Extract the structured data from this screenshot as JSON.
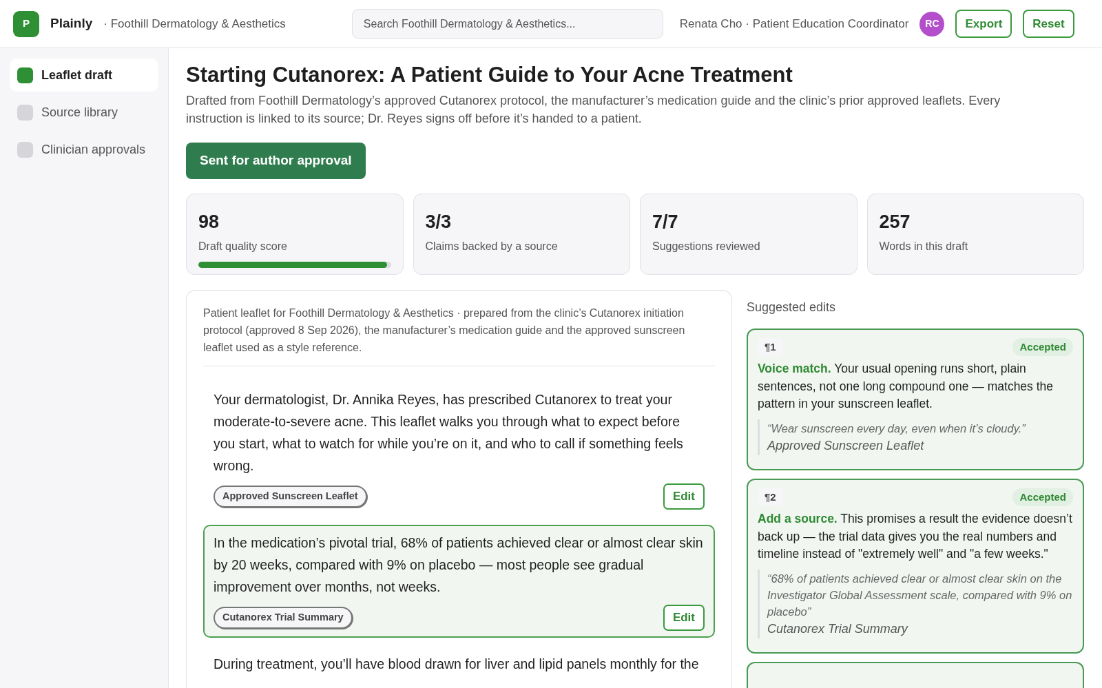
{
  "header": {
    "logo_letter": "P",
    "app_name": "Plainly",
    "org": "· Foothill Dermatology & Aesthetics",
    "search": {
      "placeholder": "Search Foothill Dermatology & Aesthetics..."
    },
    "user": "Renata Cho · Patient Education Coordinator",
    "avatar": "RC",
    "buttons": [
      "Export",
      "Reset"
    ]
  },
  "sidebar": {
    "items": [
      {
        "label": "Leaflet draft",
        "selected": true
      },
      {
        "label": "Source library",
        "selected": false
      },
      {
        "label": "Clinician approvals",
        "selected": false
      }
    ]
  },
  "page": {
    "title": "Starting Cutanorex: A Patient Guide to Your Acne Treatment",
    "description": "Drafted from Foothill Dermatology’s approved Cutanorex protocol, the manufacturer’s medication guide and the clinic’s prior approved leaflets. Every instruction is linked to its source; Dr. Reyes signs off before it’s handed to a patient.",
    "status_button": "Sent for author approval"
  },
  "stats": [
    {
      "value": "98",
      "label": "Draft quality score",
      "level": 0.98
    },
    {
      "value": "3/3",
      "label": "Claims backed by a source"
    },
    {
      "value": "7/7",
      "label": "Suggestions reviewed"
    },
    {
      "value": "257",
      "label": "Words in this draft"
    }
  ],
  "leaflet": {
    "intro": "Patient leaflet for Foothill Dermatology & Aesthetics · prepared from the clinic’s Cutanorex initiation protocol (approved 8 Sep 2026), the manufacturer’s medication guide and the approved sunscreen leaflet used as a style reference.",
    "paragraphs": [
      {
        "text": "Your dermatologist, Dr. Annika Reyes, has prescribed Cutanorex to treat your moderate-to-severe acne. This leaflet walks you through what to expect before you start, what to watch for while you’re on it, and who to call if something feels wrong.",
        "source": "Approved Sunscreen Leaflet",
        "action": "Edit",
        "selected": false
      },
      {
        "text": "In the medication’s pivotal trial, 68% of patients achieved clear or almost clear skin by 20 weeks, compared with 9% on placebo — most people see gradual improvement over months, not weeks.",
        "source": "Cutanorex Trial Summary",
        "action": "Edit",
        "selected": true
      },
      {
        "text": "During treatment, you’ll have blood drawn for liver and lipid panels monthly for the",
        "selected": false
      }
    ]
  },
  "suggestions": {
    "title": "Suggested edits",
    "items": [
      {
        "ref": "¶1",
        "status": "Accepted",
        "label": "Voice match.",
        "text": "Your usual opening runs short, plain sentences, not one long compound one — matches the pattern in your sunscreen leaflet.",
        "quote": "“Wear sunscreen every day, even when it’s cloudy.”",
        "source": "Approved Sunscreen Leaflet"
      },
      {
        "ref": "¶2",
        "status": "Accepted",
        "label": "Add a source.",
        "text": "This promises a result the evidence doesn’t back up — the trial data gives you the real numbers and timeline instead of \"extremely well\" and \"a few weeks.\"",
        "quote": "“68% of patients achieved clear or almost clear skin on the Investigator Global Assessment scale, compared with 9% on placebo”",
        "source": "Cutanorex Trial Summary"
      }
    ]
  }
}
